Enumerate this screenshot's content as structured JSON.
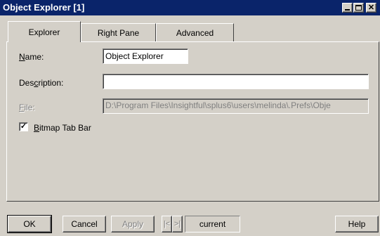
{
  "window": {
    "title": "Object Explorer [1]",
    "close_glyph": "✕"
  },
  "tabs": [
    {
      "label": "Explorer",
      "active": true
    },
    {
      "label": "Right Pane",
      "active": false
    },
    {
      "label": "Advanced",
      "active": false
    }
  ],
  "form": {
    "name_label_mnemonic": "N",
    "name_label_rest": "ame:",
    "name_value": "Object Explorer",
    "description_label_pre": "Des",
    "description_label_mnemonic": "c",
    "description_label_post": "ription:",
    "description_value": "",
    "file_label_mnemonic": "F",
    "file_label_rest": "ile:",
    "file_value": "D:\\Program Files\\Insightful\\splus6\\users\\melinda\\.Prefs\\Obje",
    "bitmap_checked": true,
    "check_glyph": "✓",
    "bitmap_label_mnemonic": "B",
    "bitmap_label_rest": "itmap Tab Bar"
  },
  "buttons": {
    "ok": "OK",
    "cancel": "Cancel",
    "apply": "Apply",
    "prev_glyph": "|<",
    "next_glyph": ">|",
    "current": "current",
    "help": "Help"
  }
}
